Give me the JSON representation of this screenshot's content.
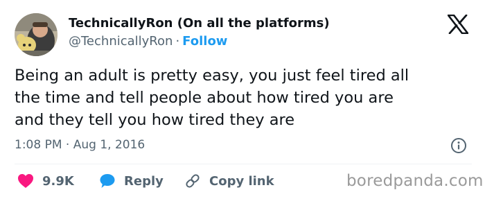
{
  "author": {
    "display_name": "TechnicallyRon (On all the platforms)",
    "handle": "@TechnicallyRon",
    "separator": "·",
    "follow_label": "Follow"
  },
  "tweet": {
    "text_lines": [
      "Being an adult is pretty easy, you just feel tired all",
      "the time and tell people about how tired you are",
      "and they tell you how tired they are"
    ],
    "time": "1:08 PM",
    "separator": "·",
    "date": "Aug 1, 2016"
  },
  "actions": {
    "likes_count": "9.9K",
    "reply_label": "Reply",
    "copy_link_label": "Copy link"
  },
  "icons": {
    "platform": "x-logo-icon",
    "info": "info-icon",
    "like": "heart-icon",
    "reply": "speech-bubble-icon",
    "copy_link": "link-icon"
  },
  "colors": {
    "text": "#0f1419",
    "secondary_text": "#536471",
    "link_blue": "#1d9bf0",
    "heart_pink": "#f91880",
    "watermark_gray": "#9a9a9a"
  },
  "watermark": "boredpanda.com"
}
